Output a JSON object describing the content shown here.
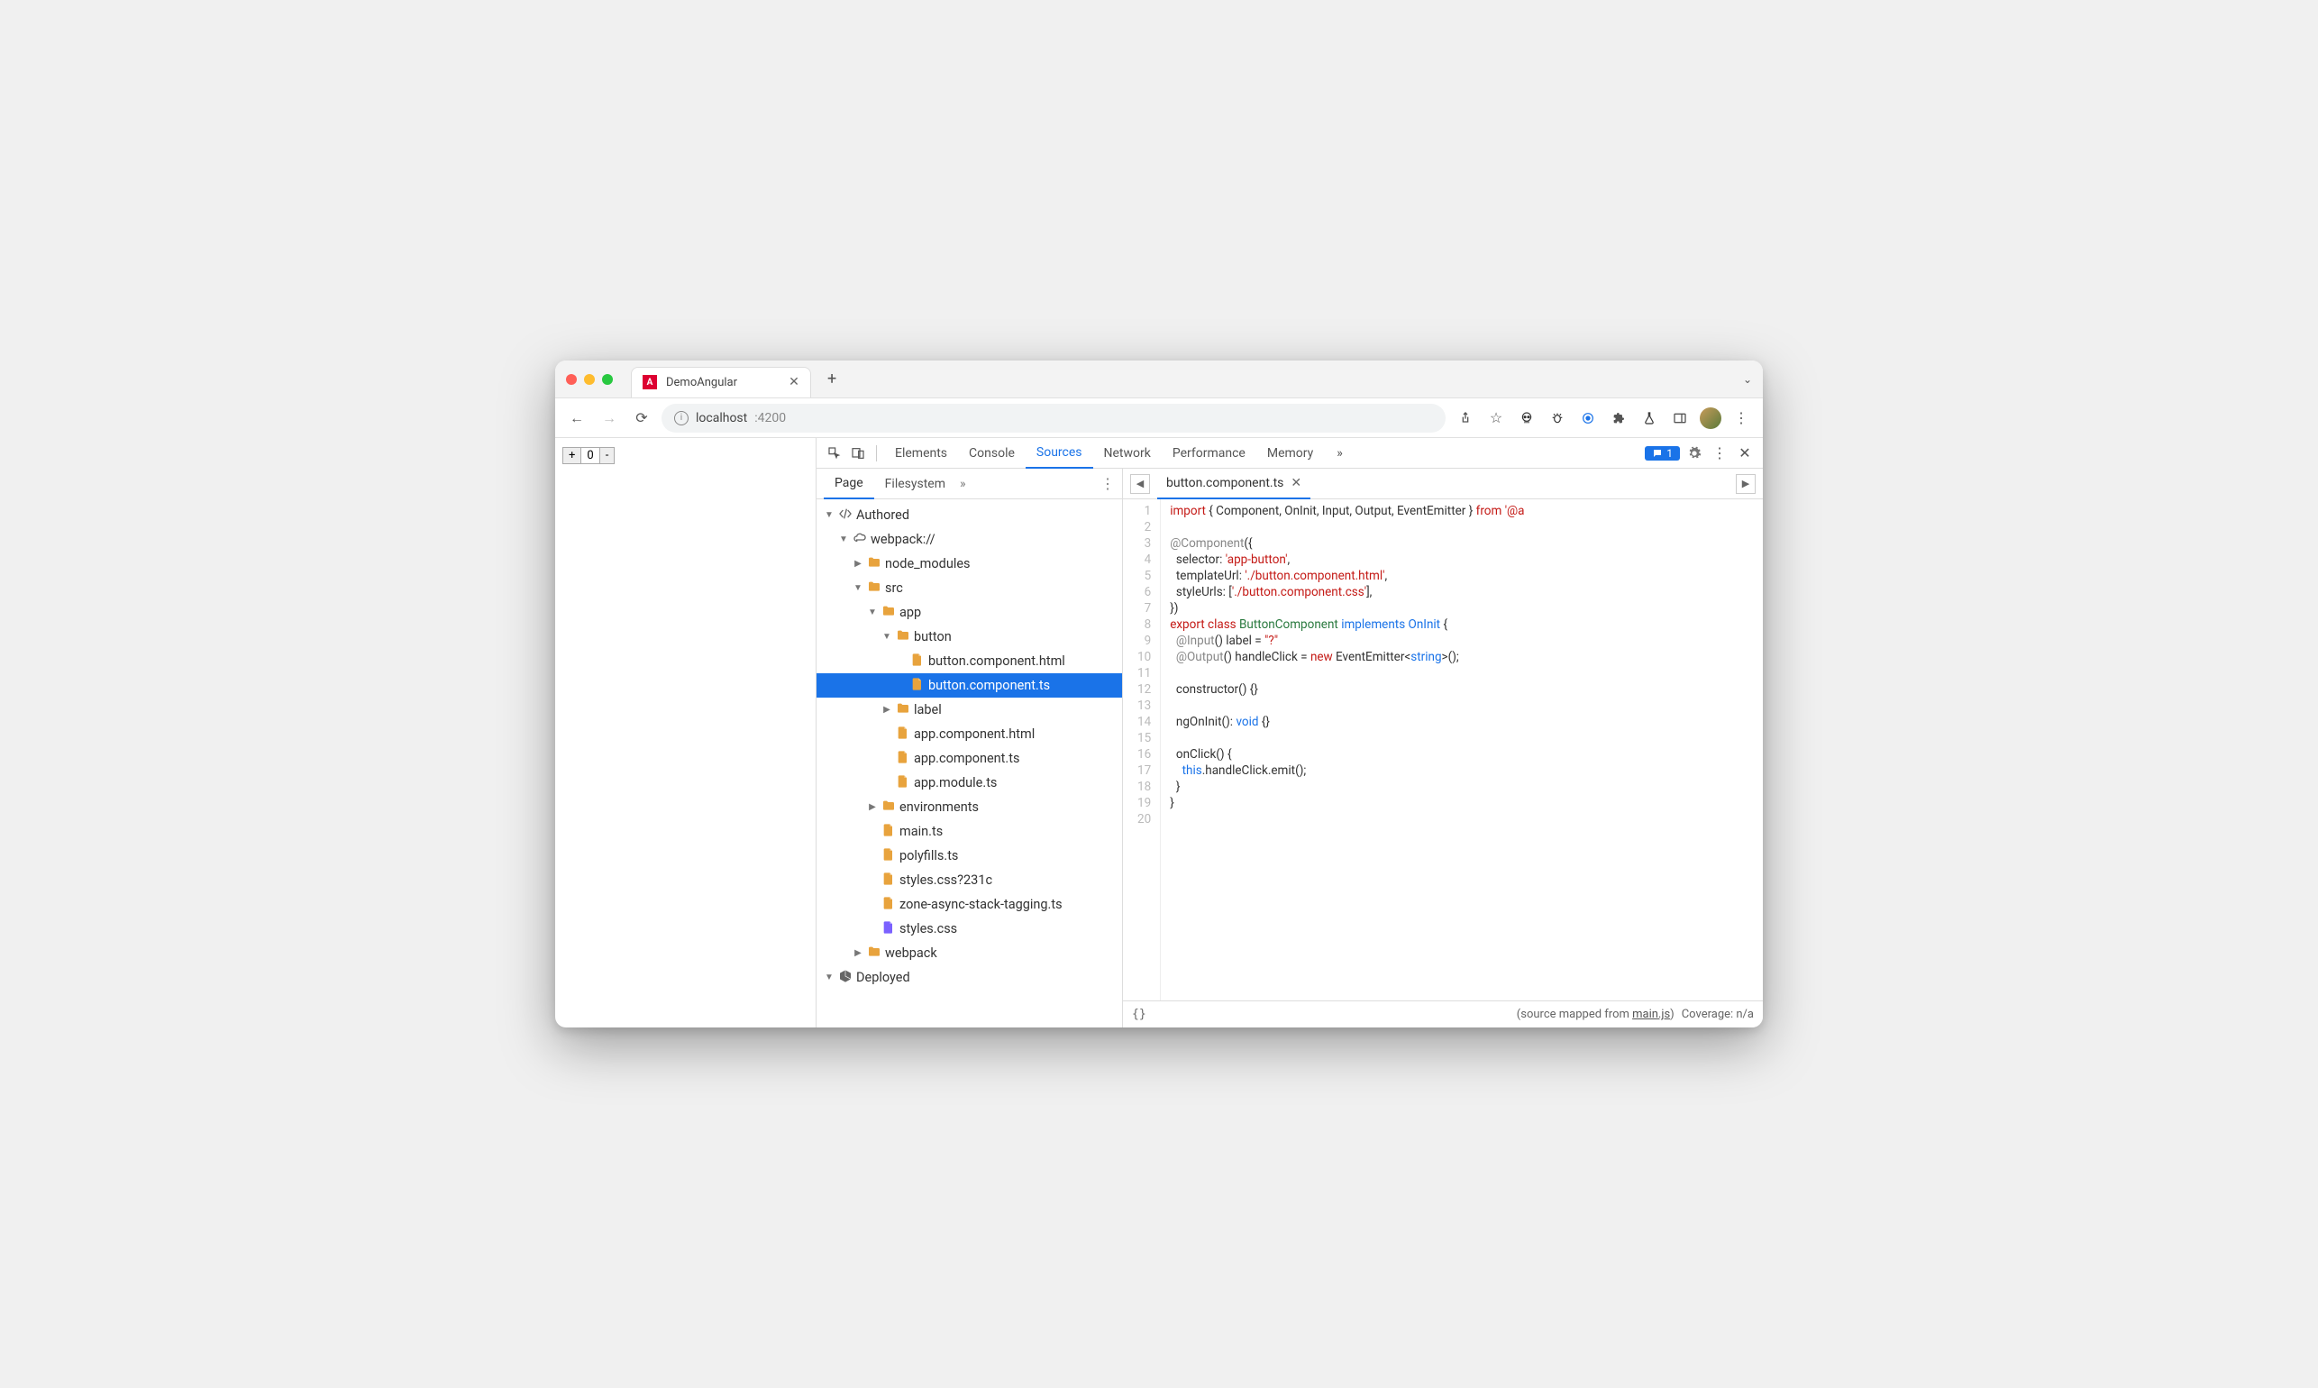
{
  "titlebar": {
    "tab_title": "DemoAngular",
    "url_host": "localhost",
    "url_port": ":4200"
  },
  "page": {
    "counter": "0",
    "plus": "+",
    "minus": "-"
  },
  "devtools": {
    "tabs": [
      "Elements",
      "Console",
      "Sources",
      "Network",
      "Performance",
      "Memory"
    ],
    "active_tab": "Sources",
    "more": "»",
    "issues_count": "1"
  },
  "sources_panel": {
    "tabs": [
      "Page",
      "Filesystem"
    ],
    "active": "Page",
    "more": "»",
    "tree": [
      {
        "depth": 0,
        "twisty": "down",
        "icon": "author",
        "label": "Authored"
      },
      {
        "depth": 1,
        "twisty": "down",
        "icon": "cloud",
        "label": "webpack://"
      },
      {
        "depth": 2,
        "twisty": "right",
        "icon": "folder",
        "label": "node_modules"
      },
      {
        "depth": 2,
        "twisty": "down",
        "icon": "folder",
        "label": "src"
      },
      {
        "depth": 3,
        "twisty": "down",
        "icon": "folder",
        "label": "app"
      },
      {
        "depth": 4,
        "twisty": "down",
        "icon": "folder",
        "label": "button"
      },
      {
        "depth": 5,
        "twisty": "",
        "icon": "file",
        "label": "button.component.html"
      },
      {
        "depth": 5,
        "twisty": "",
        "icon": "file",
        "label": "button.component.ts",
        "selected": true
      },
      {
        "depth": 4,
        "twisty": "right",
        "icon": "folder",
        "label": "label"
      },
      {
        "depth": 4,
        "twisty": "",
        "icon": "file",
        "label": "app.component.html"
      },
      {
        "depth": 4,
        "twisty": "",
        "icon": "file",
        "label": "app.component.ts"
      },
      {
        "depth": 4,
        "twisty": "",
        "icon": "file",
        "label": "app.module.ts"
      },
      {
        "depth": 3,
        "twisty": "right",
        "icon": "folder",
        "label": "environments"
      },
      {
        "depth": 3,
        "twisty": "",
        "icon": "file",
        "label": "main.ts"
      },
      {
        "depth": 3,
        "twisty": "",
        "icon": "file",
        "label": "polyfills.ts"
      },
      {
        "depth": 3,
        "twisty": "",
        "icon": "file",
        "label": "styles.css?231c"
      },
      {
        "depth": 3,
        "twisty": "",
        "icon": "file",
        "label": "zone-async-stack-tagging.ts"
      },
      {
        "depth": 3,
        "twisty": "",
        "icon": "file-purple",
        "label": "styles.css"
      },
      {
        "depth": 2,
        "twisty": "right",
        "icon": "folder",
        "label": "webpack"
      },
      {
        "depth": 0,
        "twisty": "down",
        "icon": "deploy",
        "label": "Deployed"
      }
    ]
  },
  "editor": {
    "open_file": "button.component.ts",
    "status_left_glyph": "{}",
    "status_map_prefix": "(source mapped from ",
    "status_map_link": "main.js",
    "status_map_suffix": ")",
    "status_coverage": " Coverage: n/a",
    "line_count": 20,
    "code_lines": [
      [
        {
          "t": "import",
          "c": "kw"
        },
        {
          "t": " { Component, OnInit, Input, Output, EventEmitter } ",
          "c": ""
        },
        {
          "t": "from",
          "c": "kw"
        },
        {
          "t": " ",
          "c": ""
        },
        {
          "t": "'@a",
          "c": "str"
        }
      ],
      [],
      [
        {
          "t": "@Component",
          "c": "dec"
        },
        {
          "t": "({",
          "c": ""
        }
      ],
      [
        {
          "t": "  selector: ",
          "c": ""
        },
        {
          "t": "'app-button'",
          "c": "str"
        },
        {
          "t": ",",
          "c": ""
        }
      ],
      [
        {
          "t": "  templateUrl: ",
          "c": ""
        },
        {
          "t": "'./button.component.html'",
          "c": "str"
        },
        {
          "t": ",",
          "c": ""
        }
      ],
      [
        {
          "t": "  styleUrls: [",
          "c": ""
        },
        {
          "t": "'./button.component.css'",
          "c": "str"
        },
        {
          "t": "],",
          "c": ""
        }
      ],
      [
        {
          "t": "})",
          "c": ""
        }
      ],
      [
        {
          "t": "export",
          "c": "kw"
        },
        {
          "t": " ",
          "c": ""
        },
        {
          "t": "class",
          "c": "kw"
        },
        {
          "t": " ",
          "c": ""
        },
        {
          "t": "ButtonComponent",
          "c": "cls"
        },
        {
          "t": " ",
          "c": ""
        },
        {
          "t": "implements",
          "c": "impl"
        },
        {
          "t": " ",
          "c": ""
        },
        {
          "t": "OnInit",
          "c": "type"
        },
        {
          "t": " {",
          "c": ""
        }
      ],
      [
        {
          "t": "  ",
          "c": ""
        },
        {
          "t": "@Input",
          "c": "dec"
        },
        {
          "t": "() label = ",
          "c": ""
        },
        {
          "t": "\"?\"",
          "c": "str"
        }
      ],
      [
        {
          "t": "  ",
          "c": ""
        },
        {
          "t": "@Output",
          "c": "dec"
        },
        {
          "t": "() handleClick = ",
          "c": ""
        },
        {
          "t": "new",
          "c": "new"
        },
        {
          "t": " EventEmitter<",
          "c": ""
        },
        {
          "t": "string",
          "c": "type"
        },
        {
          "t": ">();",
          "c": ""
        }
      ],
      [],
      [
        {
          "t": "  constructor() {}",
          "c": ""
        }
      ],
      [],
      [
        {
          "t": "  ngOnInit(): ",
          "c": ""
        },
        {
          "t": "void",
          "c": "type"
        },
        {
          "t": " {}",
          "c": ""
        }
      ],
      [],
      [
        {
          "t": "  onClick() {",
          "c": ""
        }
      ],
      [
        {
          "t": "    ",
          "c": ""
        },
        {
          "t": "this",
          "c": "this"
        },
        {
          "t": ".handleClick.emit();",
          "c": ""
        }
      ],
      [
        {
          "t": "  }",
          "c": ""
        }
      ],
      [
        {
          "t": "}",
          "c": ""
        }
      ],
      []
    ]
  }
}
